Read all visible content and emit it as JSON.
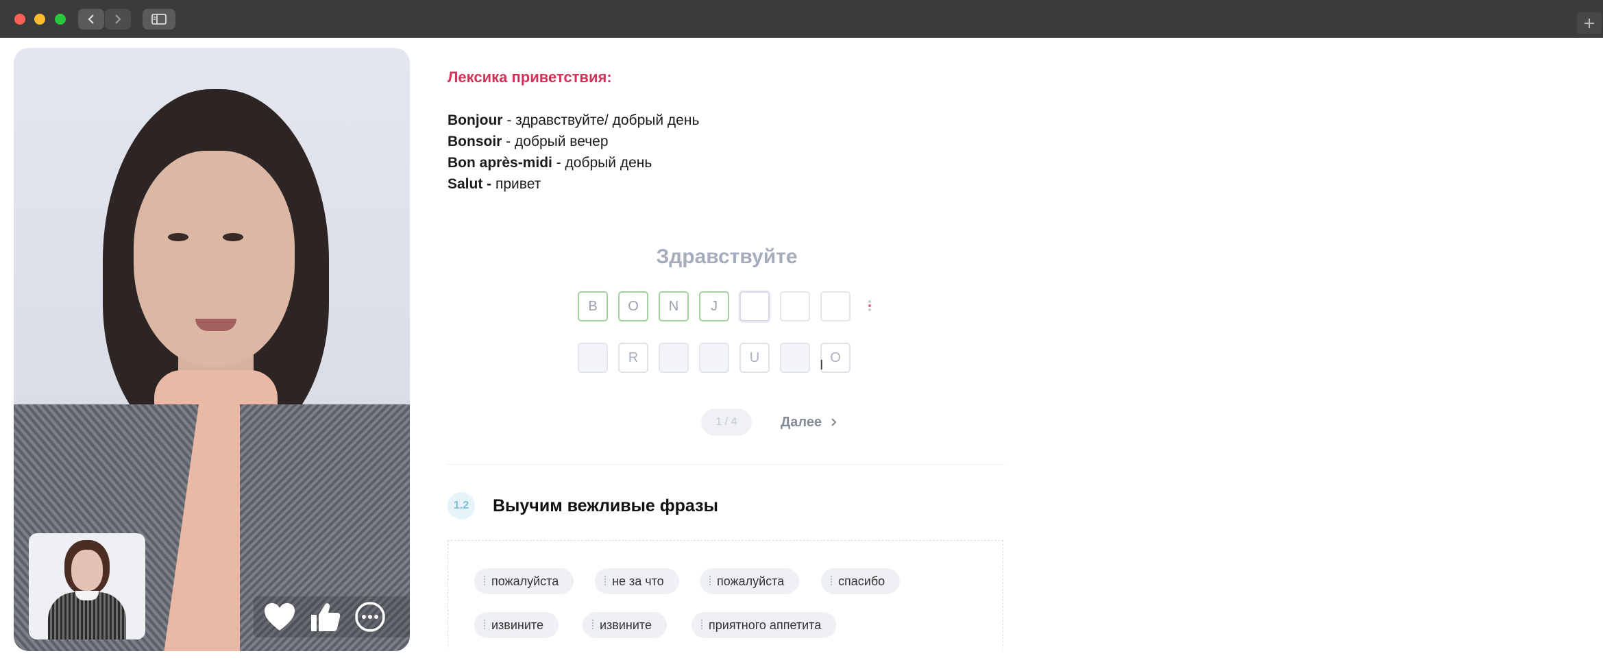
{
  "browser": {
    "back_icon": "chevron-left-icon",
    "forward_icon": "chevron-right-icon",
    "sidebar_icon": "sidebar-icon",
    "new_tab_icon": "plus-icon"
  },
  "video": {
    "reactions": [
      "heart-icon",
      "thumbs-up-icon",
      "more-icon"
    ]
  },
  "lesson": {
    "heading": "Лексика приветствия:",
    "vocab": [
      {
        "term": "Bonjour",
        "translation": " - здравствуйте/ добрый день"
      },
      {
        "term": "Bonsoir",
        "translation": " - добрый вечер"
      },
      {
        "term": "Bon après-midi",
        "translation": " - добрый день"
      },
      {
        "term": "Salut -",
        "translation": " привет"
      }
    ],
    "exercise": {
      "prompt": "Здравствуйте",
      "answer_row": [
        "B",
        "O",
        "N",
        "J",
        "",
        "",
        ""
      ],
      "letter_row": [
        "",
        "R",
        "",
        "",
        "U",
        "",
        "O"
      ],
      "pager": "1 / 4",
      "next_label": "Далее"
    },
    "section": {
      "number": "1.2",
      "title": "Выучим вежливые фразы",
      "chips_row1": [
        "пожалуйста",
        "не за что",
        "пожалуйста",
        "спасибо"
      ],
      "chips_row2": [
        "извините",
        "извините",
        "приятного аппетита"
      ]
    }
  },
  "colors": {
    "accent": "#d2335a",
    "correct_border": "#9fd29d",
    "prompt_gray": "#a5adbd"
  }
}
